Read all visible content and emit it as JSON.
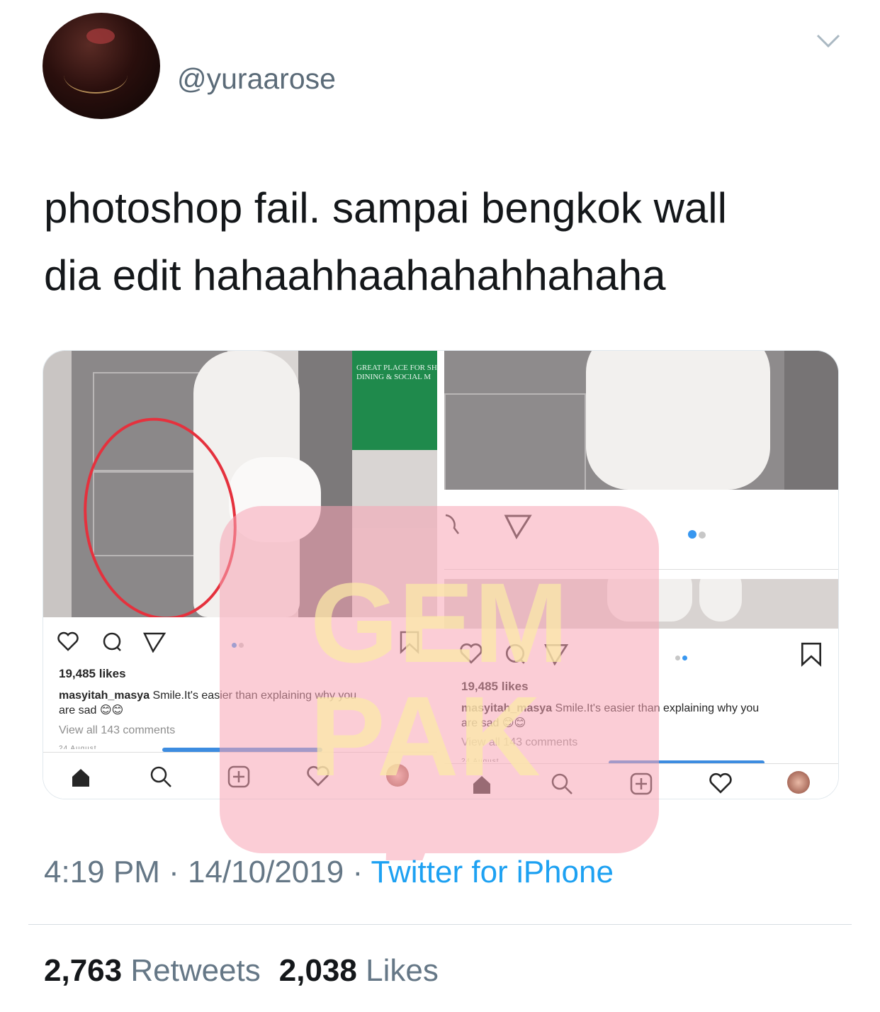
{
  "tweet": {
    "handle": "@yuraarose",
    "text_line1": "photoshop fail. sampai bengkok wall",
    "text_line2": "dia edit hahaahhaahahahhahaha",
    "time": "4:19 PM",
    "separator": "·",
    "date": "14/10/2019",
    "source": "Twitter for iPhone",
    "retweets_count": "2,763",
    "retweets_label": "Retweets",
    "likes_count": "2,038",
    "likes_label": "Likes"
  },
  "screenshots": {
    "left": {
      "sign_line1": "GREAT PLACE FOR SH",
      "sign_line2": "DINING & SOCIAL M",
      "likes": "19,485 likes",
      "username": "masyitah_masya",
      "caption": "Smile.It's easier than explaining why you",
      "caption_line2": "are sad 😊😊",
      "view_comments": "View all 143 comments",
      "date_cut": "24 August"
    },
    "right": {
      "likes": "19,485 likes",
      "username": "masyitah_masya",
      "caption": "Smile.It's easier than explaining why you",
      "caption_line2": "are sad 😊😊",
      "view_comments": "View all 143 comments",
      "date_cut": "24 August"
    }
  },
  "watermark": {
    "line1": "GEM",
    "line2": "PAK"
  },
  "colors": {
    "link": "#1da1f2",
    "muted": "#657786",
    "annotation_circle": "#e5313d",
    "watermark_pink": "#f7a4b5",
    "watermark_yellow": "#fbe9a8"
  },
  "icons": [
    "chevron-down-icon",
    "heart-icon",
    "comment-icon",
    "share-icon",
    "bookmark-icon",
    "home-icon",
    "search-icon",
    "add-icon",
    "profile-avatar-icon"
  ]
}
